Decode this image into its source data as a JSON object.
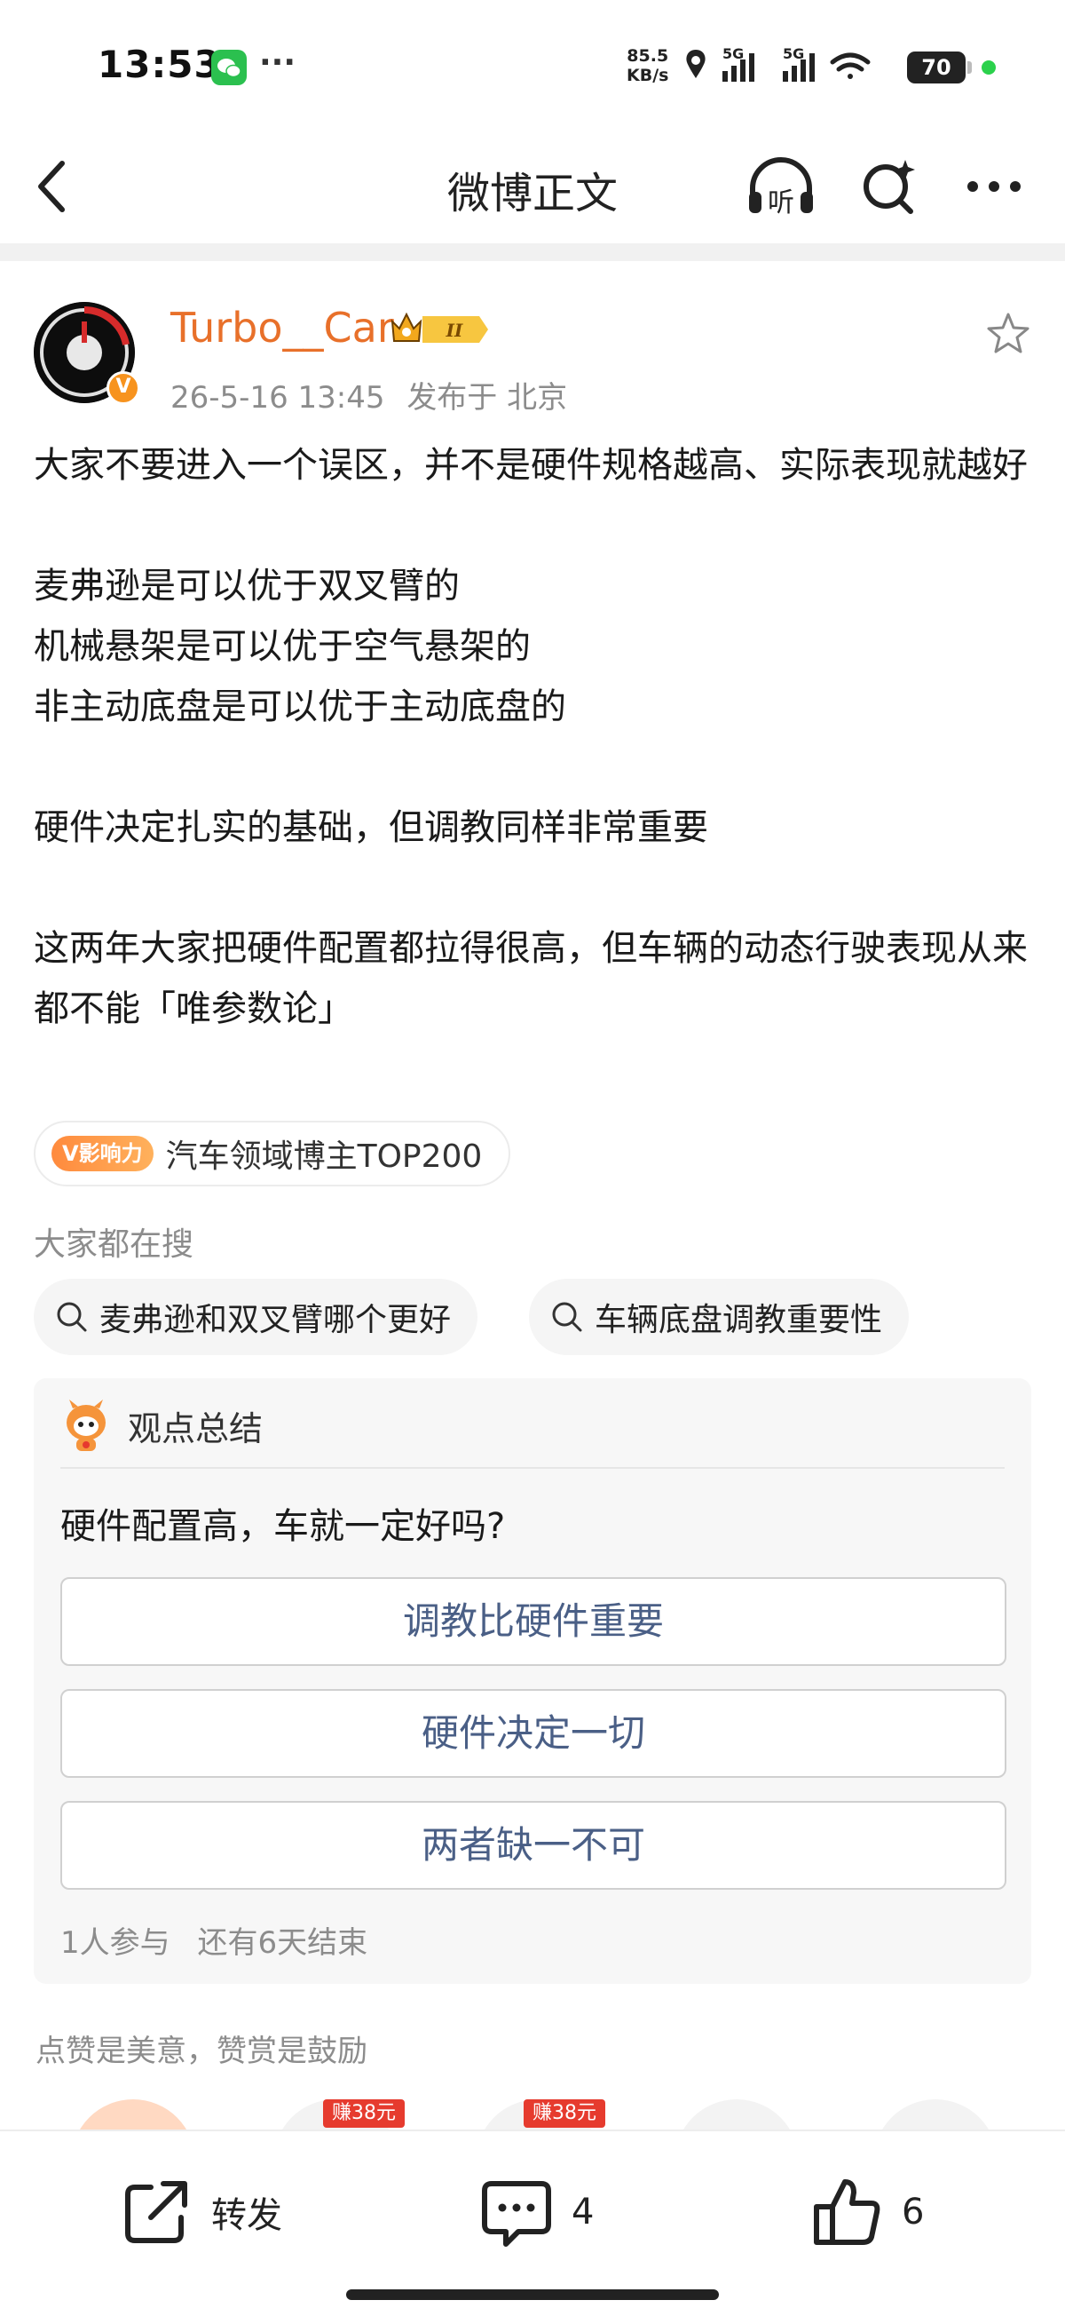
{
  "status_bar": {
    "time": "13:53",
    "speed_value": "85.5",
    "speed_unit": "KB/s",
    "network_1": "5G",
    "network_2": "5G",
    "battery": "70",
    "icons": [
      "wechat-icon",
      "location-icon",
      "signal-icon",
      "wifi-icon",
      "battery-icon"
    ]
  },
  "header": {
    "title": "微博正文",
    "listen_label": "听"
  },
  "post": {
    "author": "Turbo__Car",
    "level_badge": "II",
    "verified_mark": "V",
    "time": "26-5-16 13:45",
    "location": "发布于 北京",
    "paragraphs": [
      [
        "大家不要进入一个误区，并不是硬件规格越高、实际表现就越好"
      ],
      [
        "麦弗逊是可以优于双叉臂的",
        "机械悬架是可以优于空气悬架的",
        "非主动底盘是可以优于主动底盘的"
      ],
      [
        "硬件决定扎实的基础，但调教同样非常重要"
      ],
      [
        "这两年大家把硬件配置都拉得很高，但车辆的动态行驶表现从来都不能「唯参数论」"
      ]
    ]
  },
  "influence": {
    "badge": "V影响力",
    "text": "汽车领域博主TOP200"
  },
  "searches": {
    "label": "大家都在搜",
    "items": [
      "麦弗逊和双叉臂哪个更好",
      "车辆底盘调教重要性"
    ]
  },
  "opinion": {
    "title": "观点总结",
    "question": "硬件配置高，车就一定好吗?",
    "options": [
      "调教比硬件重要",
      "硬件决定一切",
      "两者缺一不可"
    ],
    "participants": "1人参与",
    "remaining": "还有6天结束"
  },
  "reward": {
    "text": "点赞是美意，赞赏是鼓励",
    "earn_badges": [
      "赚38元",
      "赚38元"
    ]
  },
  "bottom_bar": {
    "repost": "转发",
    "comments": "4",
    "likes": "6"
  },
  "colors": {
    "author": "#e8702a",
    "option_text": "#4a5f86",
    "muted": "#8c8c8c",
    "earn_badge": "#e63b2e"
  }
}
